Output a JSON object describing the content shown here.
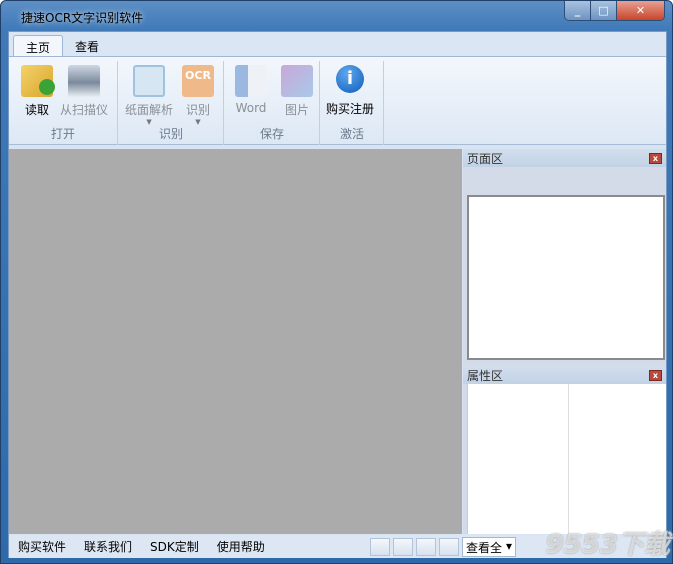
{
  "window": {
    "title": "捷速OCR文字识别软件",
    "minimize": "_",
    "maximize": "□",
    "close": "✕"
  },
  "tabs": [
    {
      "label": "主页",
      "active": true
    },
    {
      "label": "查看",
      "active": false
    }
  ],
  "ribbon": {
    "groups": [
      {
        "label": "打开",
        "buttons": [
          {
            "label": "读取",
            "icon": "folder-open-icon",
            "enabled": true
          },
          {
            "label": "从扫描仪",
            "icon": "scanner-icon",
            "enabled": false
          }
        ]
      },
      {
        "label": "识别",
        "buttons": [
          {
            "label": "纸面解析",
            "icon": "layout-edit-icon",
            "enabled": false,
            "dropdown": true
          },
          {
            "label": "识别",
            "icon": "ocr-icon",
            "enabled": false,
            "dropdown": true
          }
        ]
      },
      {
        "label": "保存",
        "buttons": [
          {
            "label": "Word",
            "icon": "word-doc-icon",
            "enabled": false
          },
          {
            "label": "图片",
            "icon": "image-file-icon",
            "enabled": false
          }
        ]
      },
      {
        "label": "激活",
        "buttons": [
          {
            "label": "购买注册",
            "icon": "info-icon",
            "enabled": true
          }
        ]
      }
    ]
  },
  "panels": {
    "page": {
      "title": "页面区",
      "close": "x"
    },
    "props": {
      "title": "属性区",
      "close": "x"
    }
  },
  "status": {
    "links": [
      "购买软件",
      "联系我们",
      "SDK定制",
      "使用帮助"
    ],
    "view_select": "查看全",
    "dropdown_arrow": "▾"
  },
  "watermark": "9553下载",
  "colors": {
    "canvas": "#ababab",
    "frame": "#3f79b8",
    "close": "#c8452c"
  }
}
